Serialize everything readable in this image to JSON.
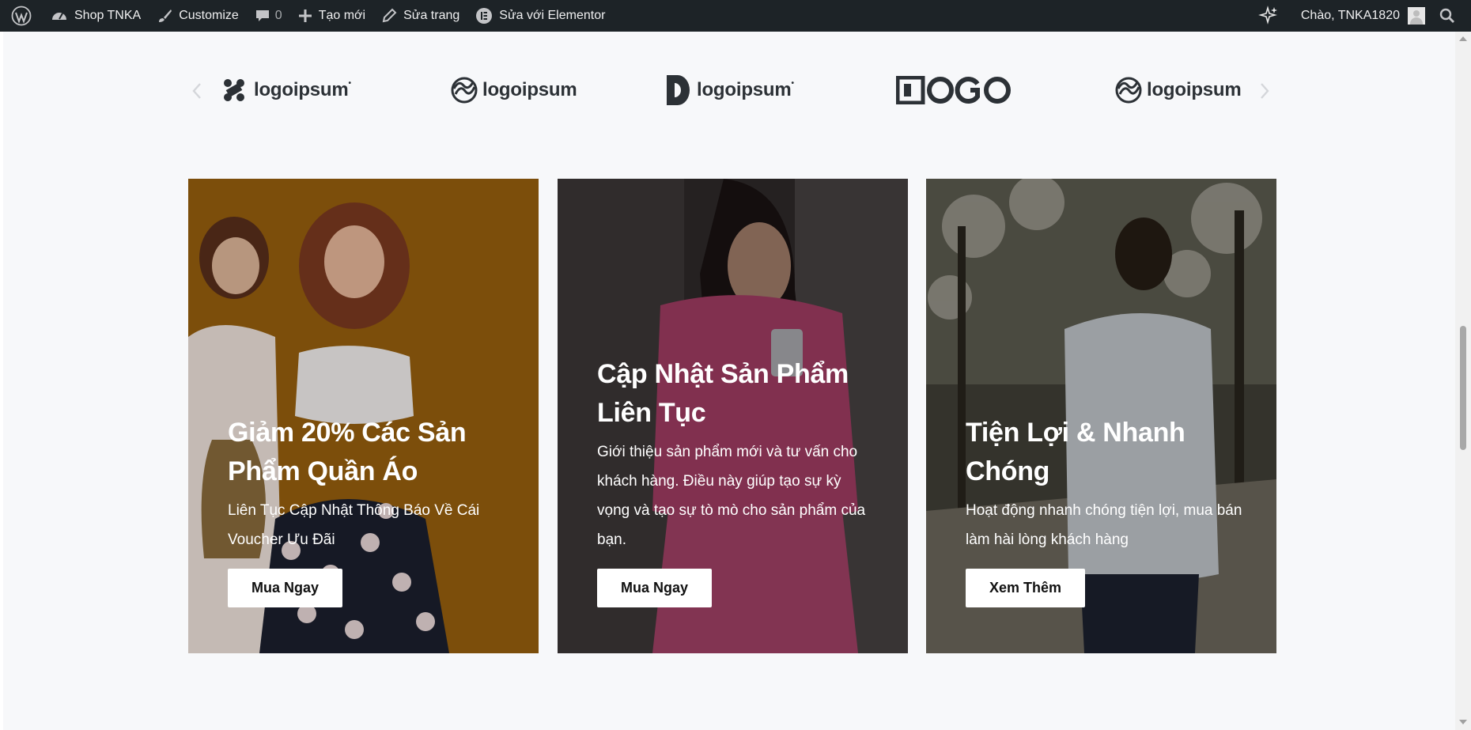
{
  "adminbar": {
    "site_name": "Shop TNKA",
    "customize": "Customize",
    "comments_count": "0",
    "new": "Tạo mới",
    "edit_page": "Sửa trang",
    "edit_elementor": "Sửa với Elementor",
    "greeting": "Chào, TNKA1820"
  },
  "carousel": {
    "logos": [
      "logoipsum",
      "logoipsum",
      "logoipsum",
      "LOGO",
      "logoipsum"
    ]
  },
  "cards": [
    {
      "title": "Giảm 20% Các Sản Phẩm Quần Áo",
      "description": "Liên Tục Cập Nhật Thông Báo Về Cái Voucher Ưu Đãi",
      "button": "Mua Ngay"
    },
    {
      "title": "Cập Nhật Sản Phẩm Liên Tục",
      "description": "Giới thiệu sản phẩm mới và tư vấn cho khách hàng. Điều này giúp tạo sự kỳ vọng và tạo sự tò mò cho sản phẩm của bạn.",
      "button": "Mua Ngay"
    },
    {
      "title": "Tiện Lợi & Nhanh Chóng",
      "description": "Hoạt động nhanh chóng tiện lợi, mua bán làm hài lòng khách hàng",
      "button": "Xem Thêm"
    }
  ],
  "colors": {
    "adminbar_bg": "#1d2327",
    "page_bg": "#f7f8fa",
    "card1_bg": "#a86b10",
    "card2_bg": "#3a3434",
    "card3_bg": "#4b4a3f"
  }
}
